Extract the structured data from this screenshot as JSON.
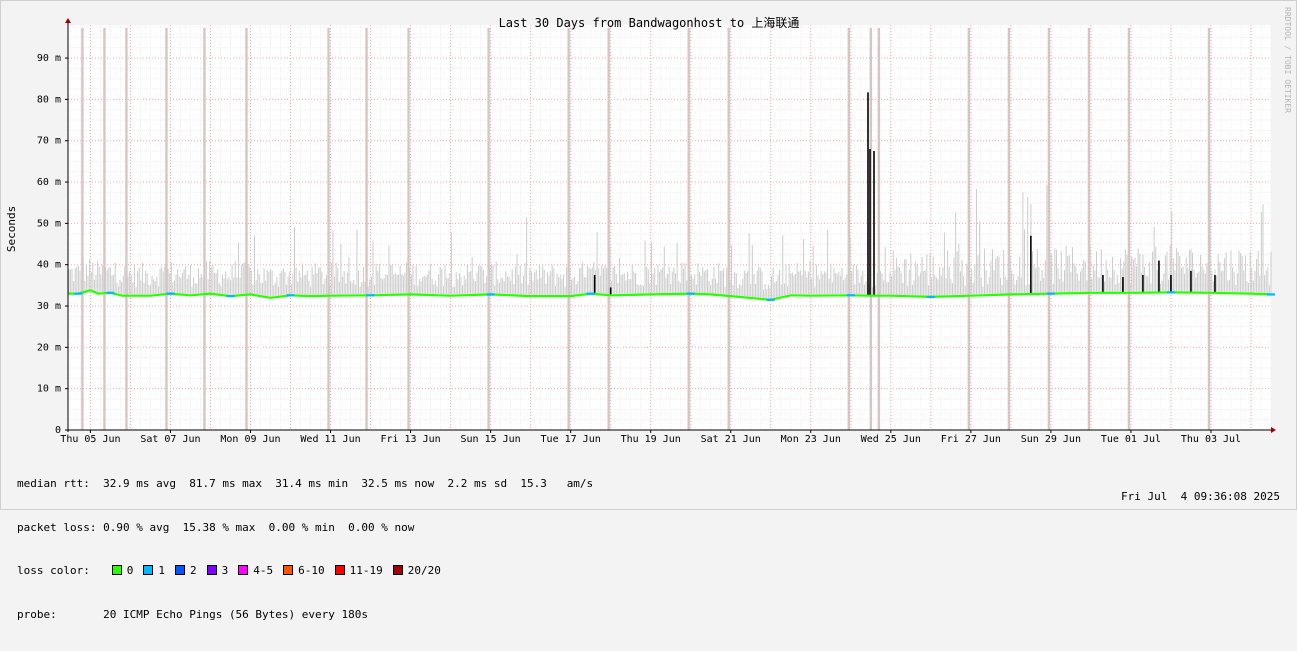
{
  "chart_data": {
    "type": "line",
    "title": "Last 30 Days from Bandwagonhost to 上海联通",
    "ylabel": "Seconds",
    "ylim": [
      0,
      98
    ],
    "yticks": [
      {
        "value": 0,
        "label": "0"
      },
      {
        "value": 10,
        "label": "10 m"
      },
      {
        "value": 20,
        "label": "20 m"
      },
      {
        "value": 30,
        "label": "30 m"
      },
      {
        "value": 40,
        "label": "40 m"
      },
      {
        "value": 50,
        "label": "50 m"
      },
      {
        "value": 60,
        "label": "60 m"
      },
      {
        "value": 70,
        "label": "70 m"
      },
      {
        "value": 80,
        "label": "80 m"
      },
      {
        "value": 90,
        "label": "90 m"
      }
    ],
    "xlim_days": [
      -0.56,
      29.5
    ],
    "xticks": [
      {
        "day": 0,
        "label": "Thu 05 Jun"
      },
      {
        "day": 2,
        "label": "Sat 07 Jun"
      },
      {
        "day": 4,
        "label": "Mon 09 Jun"
      },
      {
        "day": 6,
        "label": "Wed 11 Jun"
      },
      {
        "day": 8,
        "label": "Fri 13 Jun"
      },
      {
        "day": 10,
        "label": "Sun 15 Jun"
      },
      {
        "day": 12,
        "label": "Tue 17 Jun"
      },
      {
        "day": 14,
        "label": "Thu 19 Jun"
      },
      {
        "day": 16,
        "label": "Sat 21 Jun"
      },
      {
        "day": 18,
        "label": "Mon 23 Jun"
      },
      {
        "day": 20,
        "label": "Wed 25 Jun"
      },
      {
        "day": 22,
        "label": "Fri 27 Jun"
      },
      {
        "day": 24,
        "label": "Sun 29 Jun"
      },
      {
        "day": 26,
        "label": "Tue 01 Jul"
      },
      {
        "day": 28,
        "label": "Thu 03 Jul"
      }
    ],
    "grid": true,
    "median_baseline": [
      [
        -0.56,
        33.0
      ],
      [
        -0.3,
        33.0
      ],
      [
        0.0,
        33.8
      ],
      [
        0.2,
        33.0
      ],
      [
        0.5,
        33.2
      ],
      [
        0.8,
        32.5
      ],
      [
        1.5,
        32.5
      ],
      [
        2.0,
        33.0
      ],
      [
        2.5,
        32.6
      ],
      [
        3.0,
        33.0
      ],
      [
        3.5,
        32.4
      ],
      [
        4.0,
        32.8
      ],
      [
        4.5,
        32.0
      ],
      [
        5.0,
        32.6
      ],
      [
        5.5,
        32.4
      ],
      [
        6.0,
        32.5
      ],
      [
        7.0,
        32.6
      ],
      [
        8.0,
        32.8
      ],
      [
        9.0,
        32.5
      ],
      [
        10.0,
        32.8
      ],
      [
        11.0,
        32.4
      ],
      [
        12.0,
        32.4
      ],
      [
        12.5,
        33.0
      ],
      [
        13.0,
        32.6
      ],
      [
        14.0,
        32.8
      ],
      [
        15.0,
        33.0
      ],
      [
        15.5,
        32.8
      ],
      [
        16.0,
        32.4
      ],
      [
        17.0,
        31.5
      ],
      [
        17.5,
        32.6
      ],
      [
        18.0,
        32.5
      ],
      [
        19.0,
        32.6
      ],
      [
        19.5,
        32.5
      ],
      [
        20.0,
        32.5
      ],
      [
        21.0,
        32.2
      ],
      [
        22.0,
        32.5
      ],
      [
        23.0,
        32.8
      ],
      [
        24.0,
        33.0
      ],
      [
        25.0,
        33.2
      ],
      [
        26.0,
        33.2
      ],
      [
        27.0,
        33.3
      ],
      [
        28.0,
        33.2
      ],
      [
        29.0,
        33.0
      ],
      [
        29.5,
        32.8
      ]
    ],
    "loss_bars_days": [
      -0.2,
      0.35,
      0.9,
      1.9,
      2.85,
      3.9,
      5.95,
      6.9,
      7.95,
      9.95,
      11.95,
      12.95,
      14.95,
      15.95,
      18.95,
      19.5,
      19.7,
      21.95,
      22.95,
      23.95,
      24.95,
      25.95,
      27.95
    ],
    "spikes": [
      {
        "day": 12.6,
        "value": 37.5
      },
      {
        "day": 13.0,
        "value": 34.5
      },
      {
        "day": 19.43,
        "value": 81.7
      },
      {
        "day": 19.48,
        "value": 68.0
      },
      {
        "day": 19.58,
        "value": 67.5
      },
      {
        "day": 23.5,
        "value": 47.0
      },
      {
        "day": 25.3,
        "value": 37.5
      },
      {
        "day": 25.8,
        "value": 37.0
      },
      {
        "day": 26.3,
        "value": 37.5
      },
      {
        "day": 26.7,
        "value": 41.0
      },
      {
        "day": 27.0,
        "value": 37.5
      },
      {
        "day": 27.5,
        "value": 38.5
      },
      {
        "day": 28.1,
        "value": 37.5
      }
    ],
    "loss_colors": {
      "0": "#26ff00",
      "1": "#00b8ff",
      "2": "#0059ff",
      "3": "#7e00ff",
      "4-5": "#ff00ff",
      "6-10": "#ff5500",
      "11-19": "#ff0000",
      "20/20": "#a10000"
    }
  },
  "credit": "RRDTOOL / TOBI OETIKER",
  "stats": {
    "median_rtt_label": "median rtt:",
    "median_rtt_values": "32.9 ms avg  81.7 ms max  31.4 ms min  32.5 ms now  2.2 ms sd  15.3   am/s",
    "packet_loss_label": "packet loss:",
    "packet_loss_values": "0.90 % avg  15.38 % max  0.00 % min  0.00 % now",
    "loss_color_label": "loss color:",
    "legend": [
      {
        "label": "0",
        "color": "#26ff00"
      },
      {
        "label": "1",
        "color": "#00b8ff"
      },
      {
        "label": "2",
        "color": "#0059ff"
      },
      {
        "label": "3",
        "color": "#7e00ff"
      },
      {
        "label": "4-5",
        "color": "#ff00ff"
      },
      {
        "label": "6-10",
        "color": "#ff5500"
      },
      {
        "label": "11-19",
        "color": "#ff0000"
      },
      {
        "label": "20/20",
        "color": "#a10000"
      }
    ],
    "probe_label": "probe:",
    "probe_values": "20 ICMP Echo Pings (56 Bytes) every 180s",
    "timestamp": "Fri Jul  4 09:36:08 2025"
  }
}
